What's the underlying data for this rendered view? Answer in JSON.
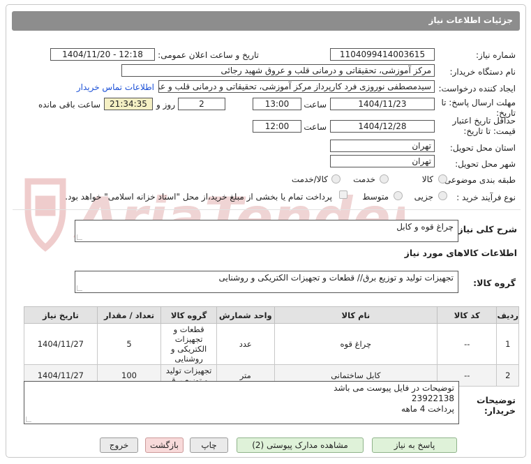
{
  "header": {
    "title": "جزئیات اطلاعات نیاز"
  },
  "form": {
    "need_number_label": "شماره نیاز:",
    "need_number": "1104099414003615",
    "announce_label": "تاریخ و ساعت اعلان عمومی:",
    "announce_value": "1404/11/20 - 12:18",
    "buyer_org_label": "نام دستگاه خریدار:",
    "buyer_org": "مرکز آموزشی، تحقیقاتی و درمانی قلب و عروق شهید رجائی",
    "requester_label": "ایجاد کننده درخواست:",
    "requester": "سیدمصطفی نوروزی فرد کارپرداز مرکز آموزشی، تحقیقاتی و درمانی قلب و عروق",
    "contact_link": "اطلاعات تماس خریدار",
    "deadline_label": "مهلت ارسال پاسخ: تا تاریخ:",
    "deadline_date": "1404/11/23",
    "time_label": "ساعت",
    "deadline_time": "13:00",
    "days_value": "2",
    "days_label": "روز و",
    "remaining_value": "21:34:35",
    "remaining_label": "ساعت باقی مانده",
    "validity_label_1": "حداقل تاریخ اعتبار",
    "validity_label_2": "قیمت: تا تاریخ:",
    "validity_date": "1404/12/28",
    "validity_time_label": "ساعت",
    "validity_time": "12:00",
    "province_label": "استان محل تحویل:",
    "province": "تهران",
    "city_label": "شهر محل تحویل:",
    "city": "تهران",
    "category_label": "طبقه بندی موضوعی:",
    "category_options": [
      "کالا",
      "خدمت",
      "کالا/خدمت"
    ],
    "process_label": "نوع فرآیند خرید :",
    "process_options": [
      "جزیی",
      "متوسط"
    ],
    "payment_note": "پرداخت تمام یا بخشی از مبلغ خرید،از محل \"اسناد خزانه اسلامی\" خواهد بود."
  },
  "summary": {
    "label": "شرح کلی نیاز:",
    "value": "چراغ قوه و کابل"
  },
  "goods_section": {
    "title": "اطلاعات کالاهای مورد نیاز",
    "group_label": "گروه کالا:",
    "group_value": "تجهیزات تولید و توزیع برق// قطعات و تجهیزات الکتریکی و روشنایی"
  },
  "table": {
    "headers": [
      "ردیف",
      "کد کالا",
      "نام کالا",
      "واحد شمارش",
      "گروه کالا",
      "تعداد / مقدار",
      "تاریخ نیاز"
    ],
    "rows": [
      {
        "row": "1",
        "code": "--",
        "name": "چراغ قوه",
        "unit": "عدد",
        "group": "قطعات و تجهیزات الکتریکی و روشنایی",
        "qty": "5",
        "date": "1404/11/27"
      },
      {
        "row": "2",
        "code": "--",
        "name": "کابل ساختمانی",
        "unit": "متر",
        "group": "تجهیزات تولید و توزیع برق",
        "qty": "100",
        "date": "1404/11/27"
      }
    ]
  },
  "buyer_notes": {
    "label_1": "توضیحات",
    "label_2": "خریدار:",
    "line_1": "توضیحات در فایل پیوست می باشد",
    "line_2": "23922138",
    "line_3": "پرداخت 4 ماهه"
  },
  "buttons": {
    "reply": "پاسخ به نیاز",
    "docs": "مشاهده مدارک پیوستی (2)",
    "print": "چاپ",
    "back": "بازگشت",
    "exit": "خروج"
  },
  "watermark_text": "AriaTender.neT",
  "colors": {
    "header_bg": "#8d8d8d",
    "link": "#1a4fd6",
    "remaining_bg": "#f5f0c4",
    "watermark": "#e6b7b7"
  }
}
